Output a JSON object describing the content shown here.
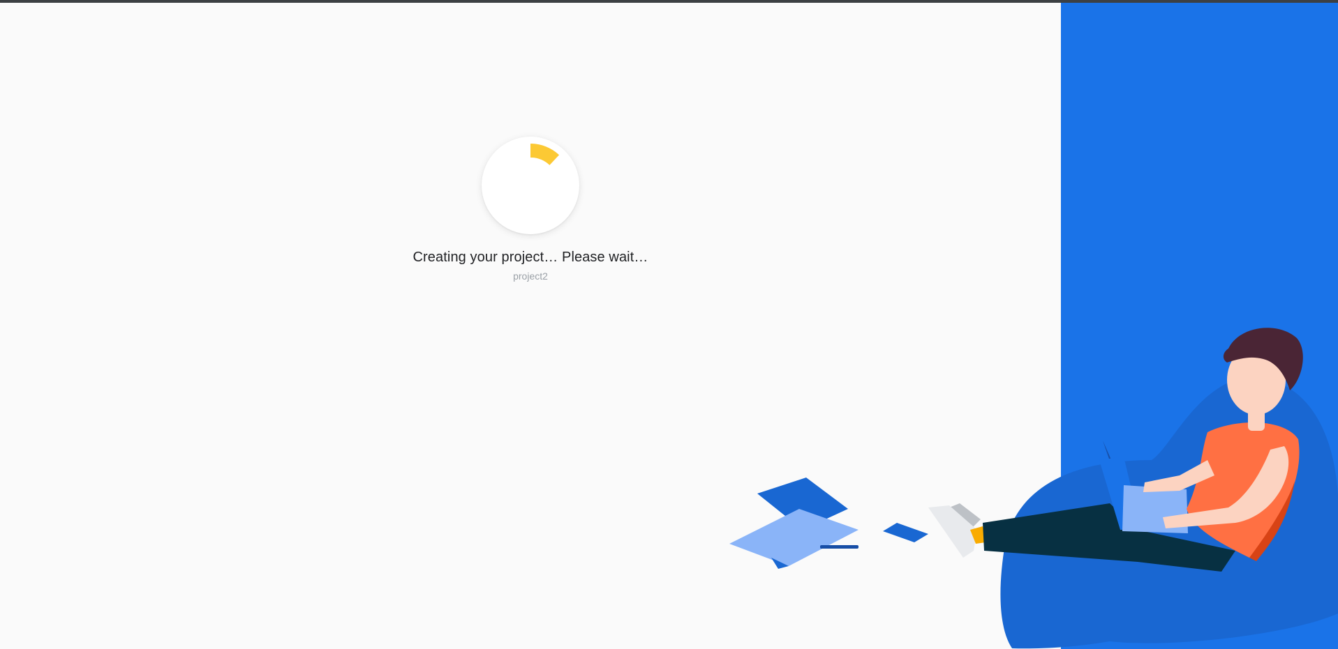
{
  "status": {
    "title": "Creating your project… Please wait…",
    "project_name": "project2",
    "progress_fraction": 0.12
  },
  "colors": {
    "accent_blue": "#1a73e8",
    "spinner_yellow": "#fcc934",
    "background": "#fafafa",
    "top_bar": "#3c4043"
  },
  "icons": {
    "spinner": "progress-spinner-icon",
    "illustration": "person-with-laptop-illustration"
  }
}
